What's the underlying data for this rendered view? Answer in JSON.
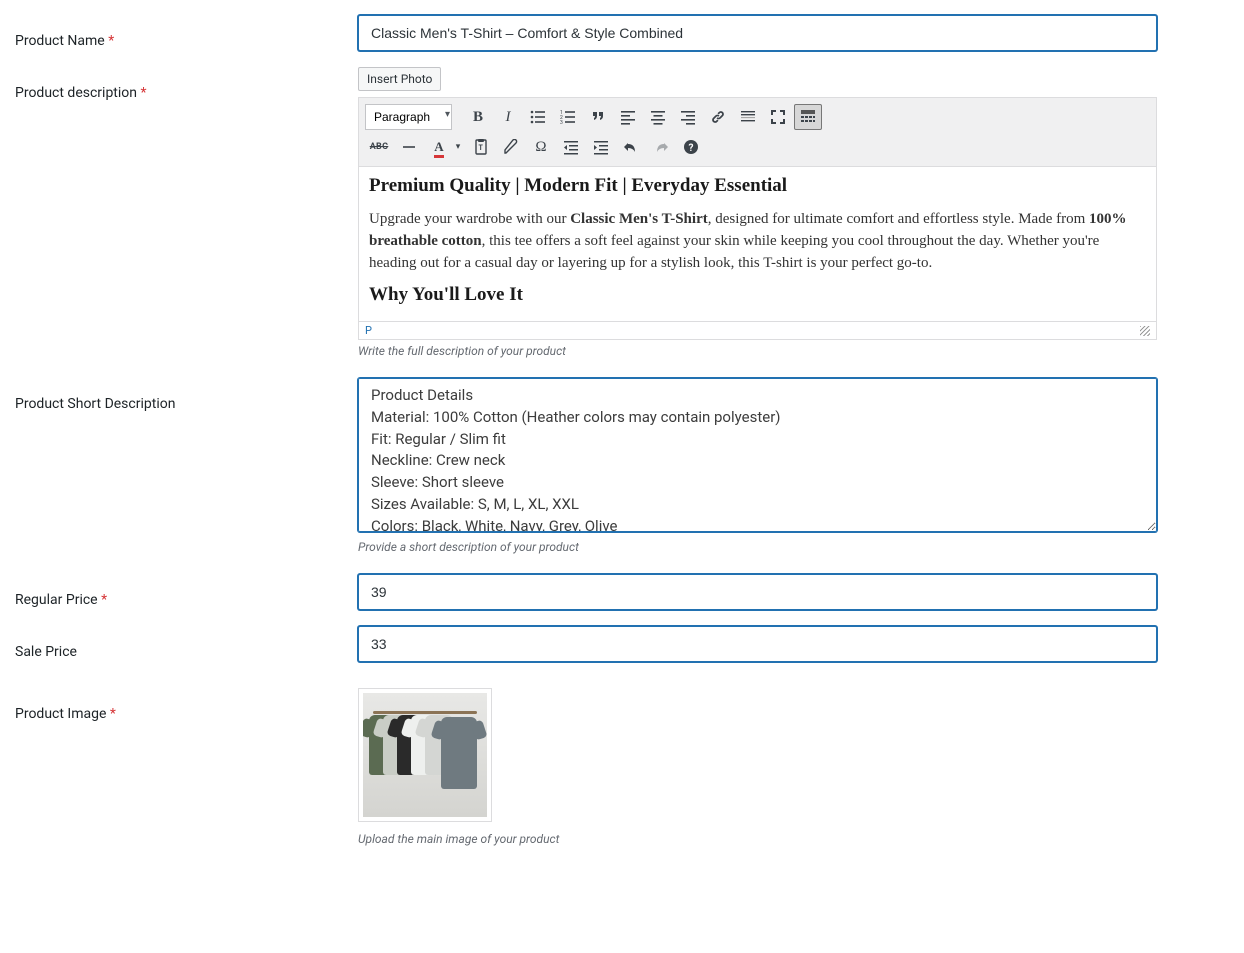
{
  "labels": {
    "product_name": "Product Name",
    "product_description": "Product description",
    "product_short_description": "Product Short Description",
    "regular_price": "Regular Price",
    "sale_price": "Sale Price",
    "product_image": "Product Image"
  },
  "required_marker": "*",
  "product_name_value": "Classic Men's T-Shirt – Comfort & Style Combined",
  "insert_photo_label": "Insert Photo",
  "editor": {
    "format_select": "Paragraph",
    "status_path": "P",
    "content": {
      "heading1": "Premium Quality | Modern Fit | Everyday Essential",
      "para_part1": "Upgrade your wardrobe with our ",
      "para_bold1": "Classic Men's T-Shirt",
      "para_part2": ", designed for ultimate comfort and effortless style. Made from ",
      "para_bold2": "100% breathable cotton",
      "para_part3": ", this tee offers a soft feel against your skin while keeping you cool throughout the day. Whether you're heading out for a casual day or layering up for a stylish look, this T-shirt is your perfect go-to.",
      "heading2": "Why You'll Love It"
    }
  },
  "hints": {
    "description": "Write the full description of your product",
    "short_description": "Provide a short description of your product",
    "product_image": "Upload the main image of your product"
  },
  "short_description_value": "Product Details\nMaterial: 100% Cotton (Heather colors may contain polyester)\nFit: Regular / Slim fit\nNeckline: Crew neck\nSleeve: Short sleeve\nSizes Available: S, M, L, XL, XXL\nColors: Black, White, Navy, Grey, Olive",
  "regular_price_value": "39",
  "sale_price_value": "33"
}
